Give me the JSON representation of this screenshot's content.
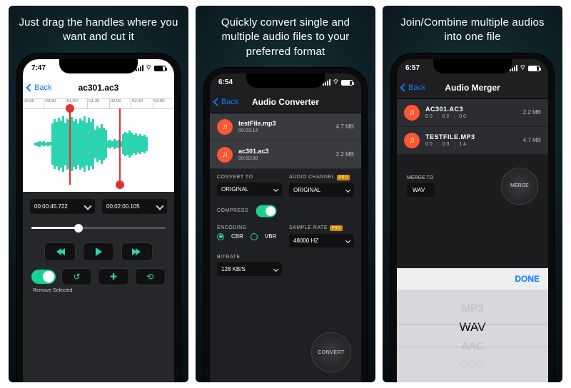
{
  "panel1": {
    "caption": "Just drag the handles where you want and cut it",
    "status_time": "7:47",
    "back": "Back",
    "title": "ac301.ac3",
    "timeline": [
      "00:00",
      "00:30",
      "01:00",
      "01:30",
      "02:00",
      "02:30",
      "03:00"
    ],
    "start_time": "00:00:45.722",
    "end_time": "00:02:00.105",
    "remove_label": "Remove Selected"
  },
  "panel2": {
    "caption": "Quickly convert single and multiple audio files to your preferred format",
    "status_time": "6:54",
    "back": "Back",
    "title": "Audio Converter",
    "files": [
      {
        "name": "testFile.mp3",
        "dur": "00:03:14",
        "size": "4.7 MB"
      },
      {
        "name": "ac301.ac3",
        "dur": "00:02:00",
        "size": "2.2 MB"
      }
    ],
    "labels": {
      "convert_to": "CONVERT TO",
      "audio_channel": "AUDIO CHANNEL",
      "compress": "COMPRESS",
      "encoding": "ENCODING",
      "sample_rate": "SAMPLE RATE",
      "bitrate": "BITRATE"
    },
    "values": {
      "convert_to": "ORIGINAL",
      "audio_channel": "ORIGINAL",
      "sample_rate": "48000 HZ",
      "bitrate": "128 KB/S",
      "enc_cbr": "CBR",
      "enc_vbr": "VBR"
    },
    "convert_btn": "CONVERT"
  },
  "panel3": {
    "caption": "Join/Combine multiple audios into one file",
    "status_time": "6:57",
    "back": "Back",
    "title": "Audio Merger",
    "files": [
      {
        "name": "AC301.AC3",
        "dur": "00 : 02 : 00",
        "size": "2.2 MB"
      },
      {
        "name": "TESTFILE.MP3",
        "dur": "00 : 03 : 14",
        "size": "4.7 MB"
      }
    ],
    "merge_to_label": "MERGE TO",
    "merge_to_value": "WAV",
    "merge_btn": "MERGE",
    "done": "DONE",
    "picker": [
      "MP3",
      "WAV",
      "AAC",
      "OGG"
    ],
    "picker_selected": "WAV"
  }
}
